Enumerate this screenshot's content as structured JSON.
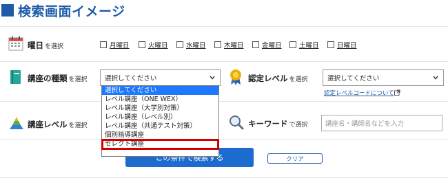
{
  "heading": {
    "title": "検索画面イメージ"
  },
  "days": {
    "label": "曜日",
    "label_sub": "を選択",
    "items": [
      "月曜日",
      "火曜日",
      "水曜日",
      "木曜日",
      "金曜日",
      "土曜日",
      "日曜日"
    ]
  },
  "course_type": {
    "label": "講座の種類",
    "label_sub": "を選択",
    "selected": "選択してください",
    "options": [
      "選択してください",
      "レベル講座（ONE WEX）",
      "レベル講座（大学別対策）",
      "レベル講座（レベル別）",
      "レベル講座（共通テスト対策）",
      "個別指導講座",
      "セレクト講座"
    ]
  },
  "cert_level": {
    "label": "認定レベル",
    "label_sub": "を選択",
    "selected": "選択してください",
    "code_link": "認定レベルコードについて"
  },
  "course_level": {
    "label": "講座レベル",
    "label_sub": "を選択"
  },
  "keyword": {
    "label": "キーワード",
    "label_sub": "で選択",
    "placeholder": "講座名・講師名などを入力"
  },
  "actions": {
    "submit": "この条件で検索する",
    "clear": "クリア"
  },
  "colors": {
    "accent": "#1e5aa8",
    "button": "#1e6bd0",
    "selected_option": "#1e78ff",
    "highlight": "#d10000"
  }
}
